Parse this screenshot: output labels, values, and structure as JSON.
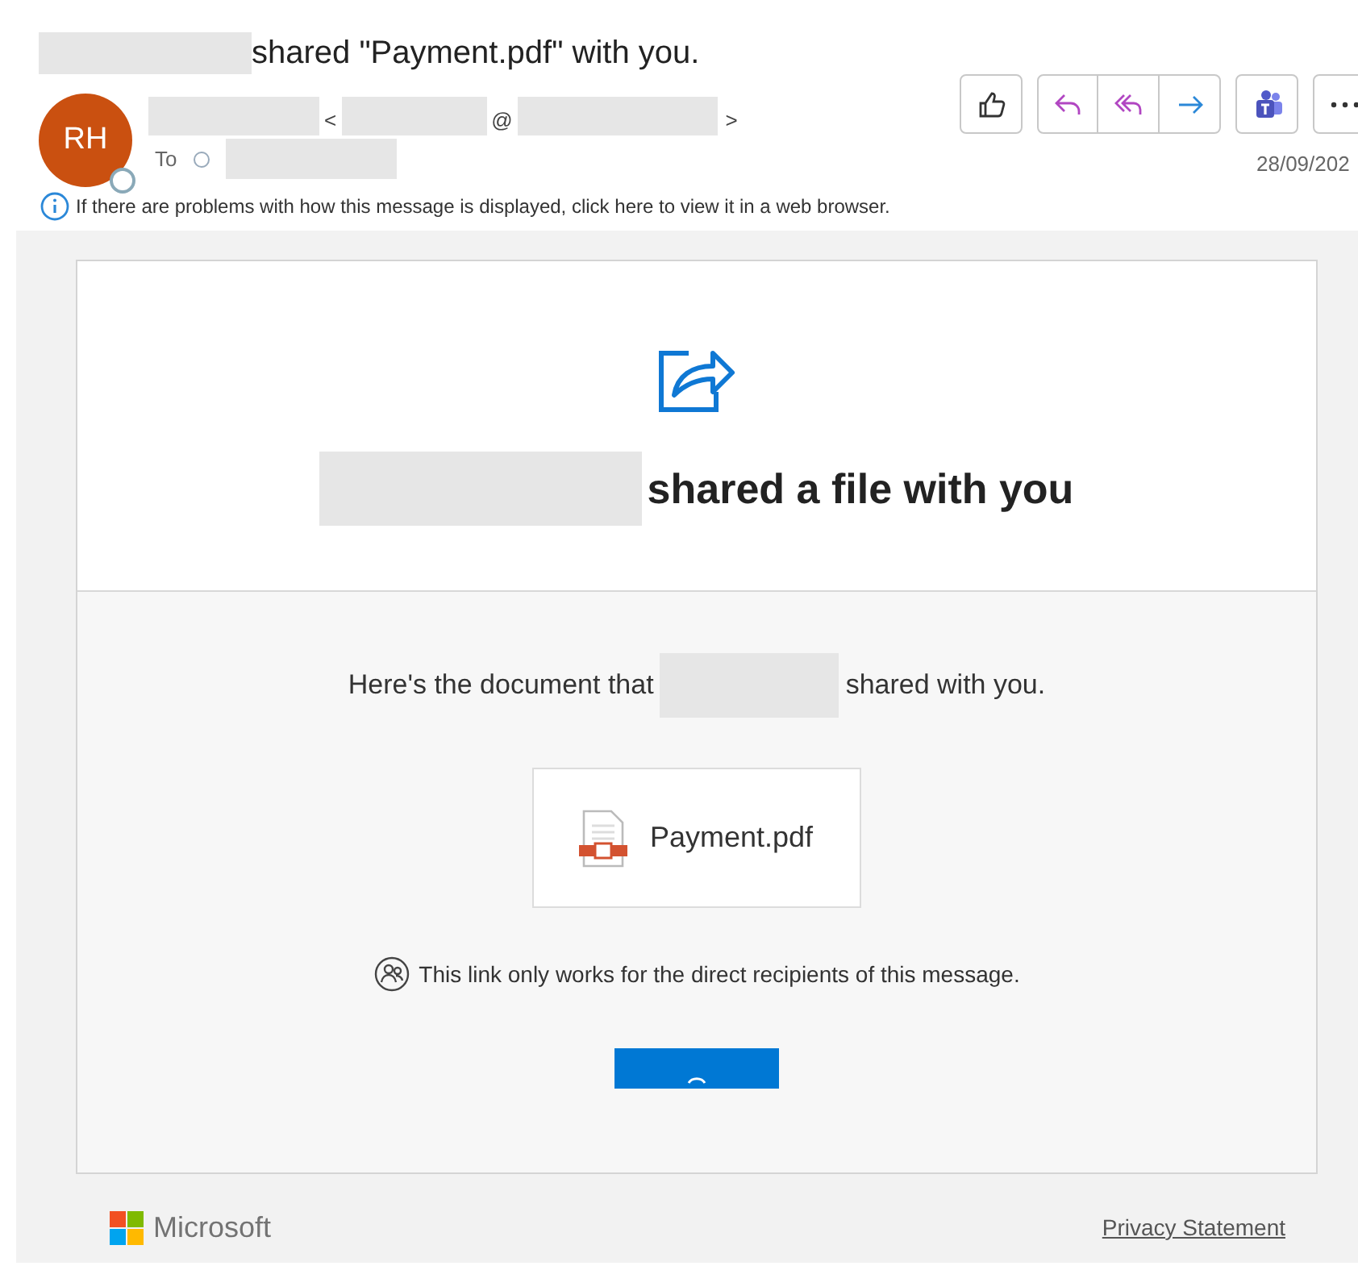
{
  "message": {
    "subject": "shared \"Payment.pdf\" with you.",
    "avatar_initials": "RH",
    "sender_punctuation": [
      "<",
      "@",
      ">"
    ],
    "to_label": "To",
    "date": "28/09/202",
    "info_bar": "If there are problems with how this message is displayed, click here to view it in a web browser."
  },
  "toolbar": [
    {
      "kind": "like"
    },
    {
      "kind": "reply"
    },
    {
      "kind": "reply_all"
    },
    {
      "kind": "forward"
    },
    {
      "kind": "teams"
    },
    {
      "kind": "more"
    }
  ],
  "card": {
    "heading": "shared a file with you",
    "intro_before": "Here's the document that",
    "intro_after": "shared with you.",
    "file_name": "Payment.pdf",
    "notice": "This link only works for the direct recipients of this message."
  },
  "footer": {
    "brand": "Microsoft",
    "privacy_link": "Privacy Statement"
  }
}
